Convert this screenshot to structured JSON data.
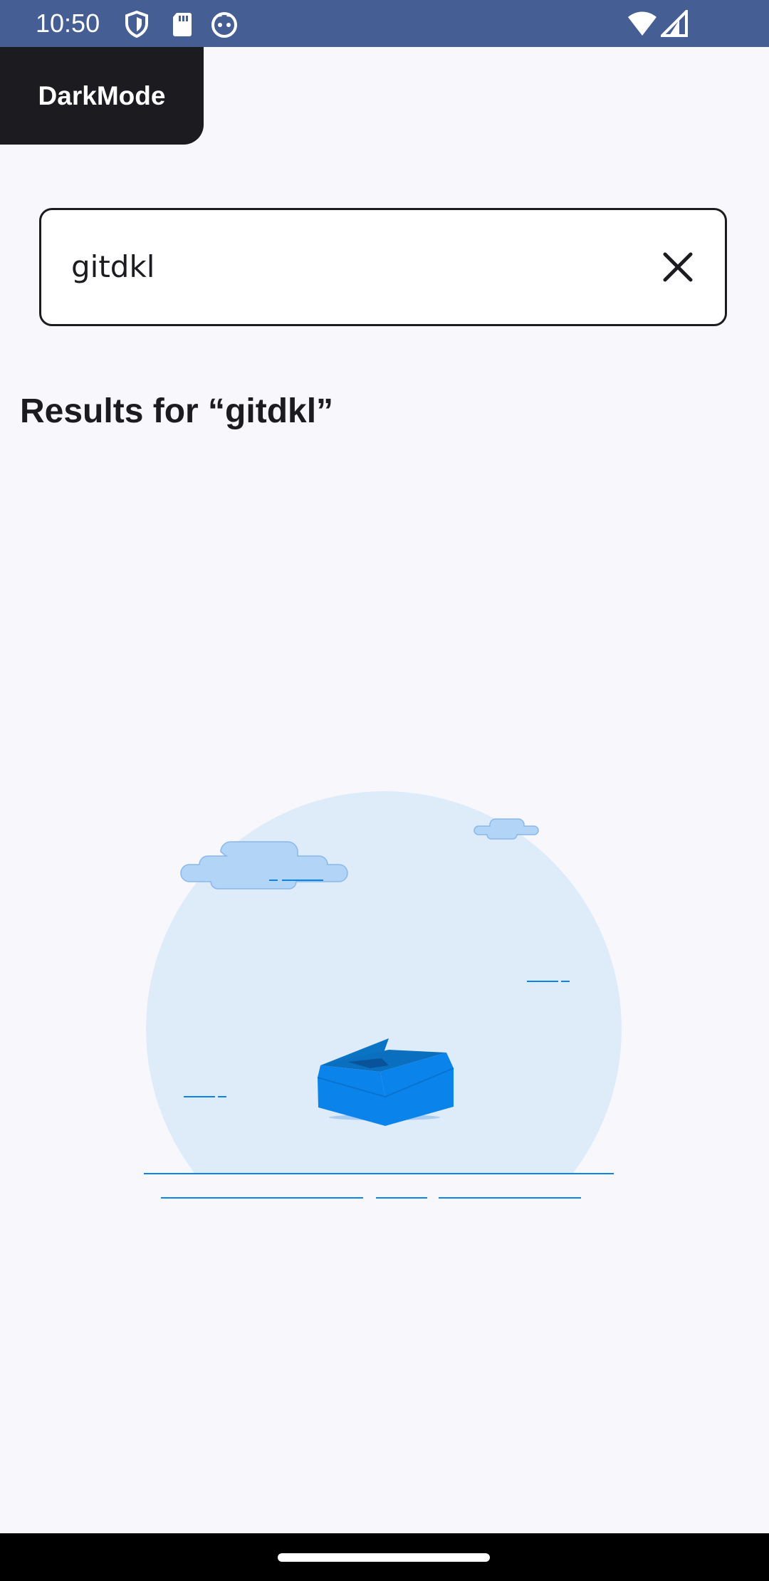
{
  "status_bar": {
    "time": "10:50",
    "icons": [
      "shield-icon",
      "sd-card-icon",
      "cat-face-icon",
      "wifi-icon",
      "cell-signal-icon"
    ],
    "background": "#455e93"
  },
  "app": {
    "dark_mode_label": "DarkMode"
  },
  "search": {
    "value": "gitdkl",
    "clear_icon": "close-icon"
  },
  "results": {
    "title": "Results for “gitdkl”"
  },
  "empty_state": {
    "illustration": "empty-box-illustration",
    "accent_color": "#0a84ea",
    "circle_color": "#deecfa",
    "cloud_color": "#b1d4f7"
  }
}
